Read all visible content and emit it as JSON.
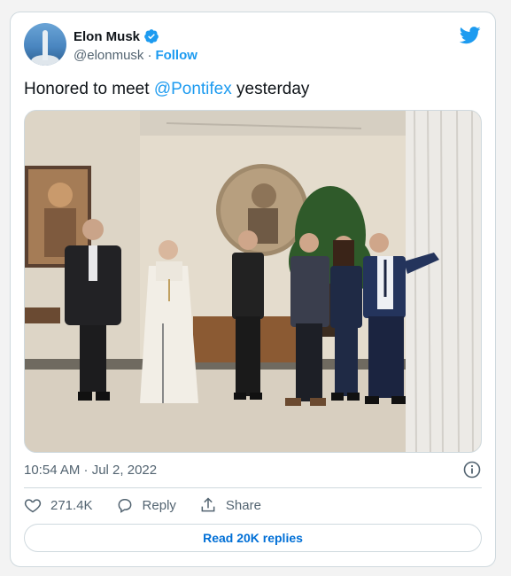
{
  "author": {
    "name": "Elon Musk",
    "handle": "@elonmusk",
    "separator": "·",
    "follow_label": "Follow"
  },
  "tweet": {
    "text_before": "Honored to meet ",
    "mention": "@Pontifex",
    "text_after": " yesterday",
    "timestamp": "10:54 AM · Jul 2, 2022"
  },
  "actions": {
    "like_count": "271.4K",
    "reply_label": "Reply",
    "share_label": "Share"
  },
  "read_replies_label": "Read 20K replies",
  "colors": {
    "accent": "#1d9bf0",
    "link_dark": "#006fd6",
    "muted": "#536471",
    "border": "#cfd9de"
  },
  "icons": [
    "verified-badge-icon",
    "twitter-bird-icon",
    "info-icon",
    "heart-icon",
    "reply-icon",
    "share-icon"
  ]
}
